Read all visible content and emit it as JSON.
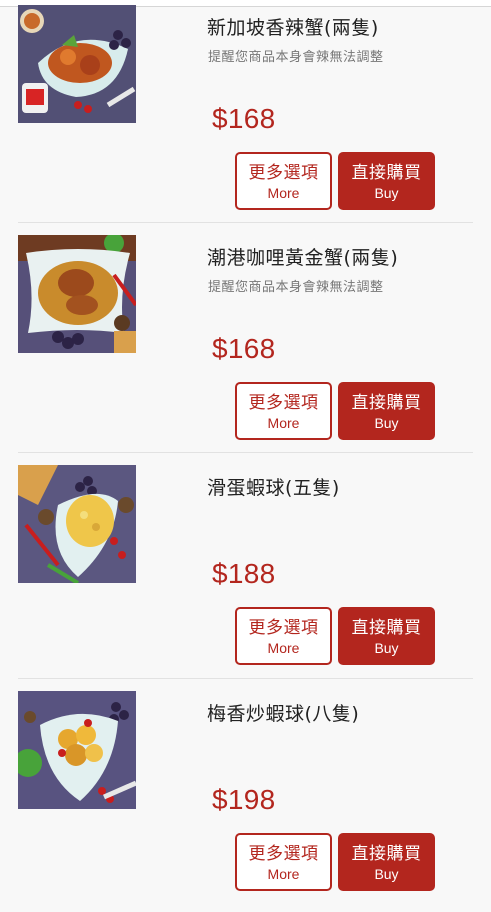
{
  "buttons": {
    "more_zh": "更多選項",
    "more_en": "More",
    "buy_zh": "直接購買",
    "buy_en": "Buy"
  },
  "products": [
    {
      "name": "新加坡香辣蟹(兩隻)",
      "note": "提醒您商品本身會辣無法調整",
      "price": "$168",
      "image_icon": "crab-dish-image"
    },
    {
      "name": "潮港咖哩黃金蟹(兩隻)",
      "note": "提醒您商品本身會辣無法調整",
      "price": "$168",
      "image_icon": "curry-crab-dish-image"
    },
    {
      "name": "滑蛋蝦球(五隻)",
      "note": "",
      "price": "$188",
      "image_icon": "egg-shrimp-dish-image"
    },
    {
      "name": "梅香炒蝦球(八隻)",
      "note": "",
      "price": "$198",
      "image_icon": "plum-shrimp-dish-image"
    }
  ],
  "colors": {
    "accent": "#b3261e",
    "background": "#f8f8f8"
  }
}
